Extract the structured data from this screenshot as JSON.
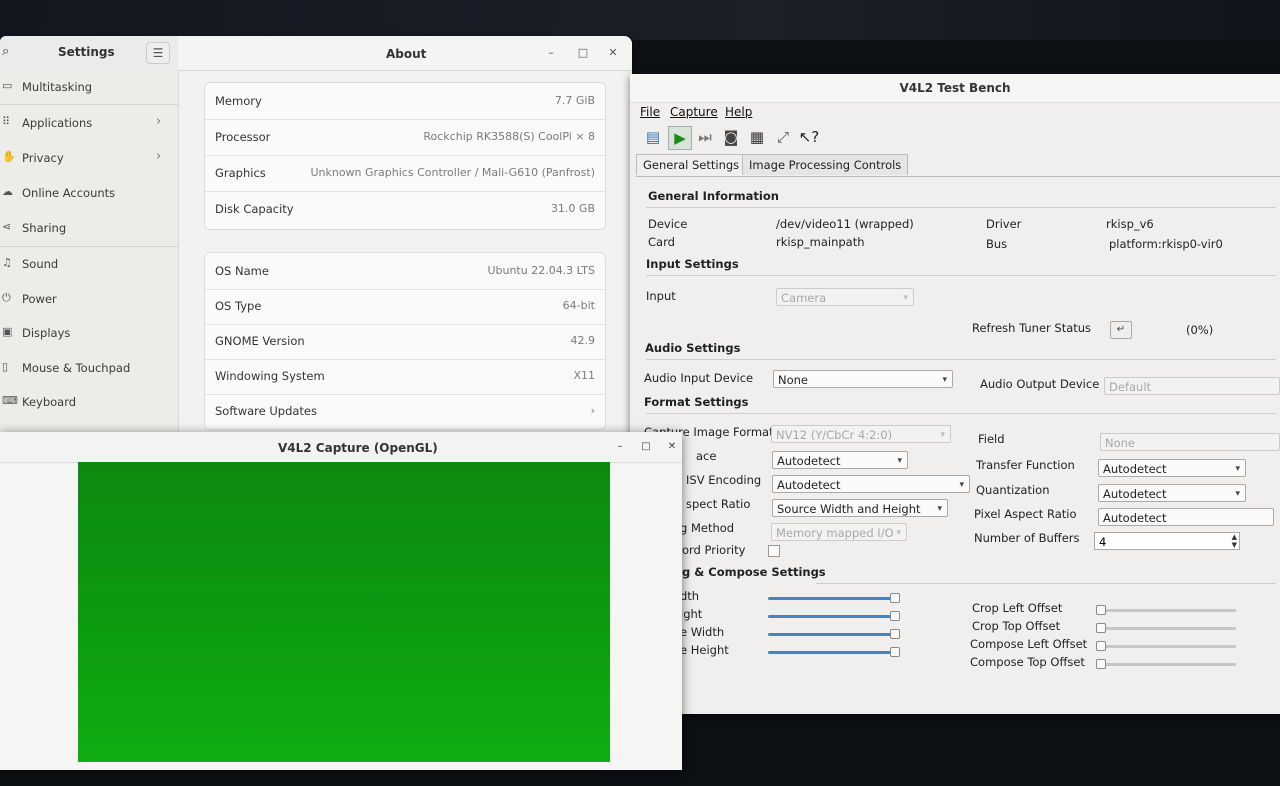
{
  "settings": {
    "title": "Settings",
    "page_title": "About",
    "window_controls": {
      "minimize": "–",
      "maximize": "□",
      "close": "✕"
    },
    "sidebar": [
      {
        "label": "Multitasking",
        "icon": "multitasking-icon",
        "chevron": ""
      },
      {
        "label": "Applications",
        "icon": "applications-icon",
        "chevron": "›"
      },
      {
        "label": "Privacy",
        "icon": "privacy-icon",
        "chevron": "›"
      },
      {
        "label": "Online Accounts",
        "icon": "online-accounts-icon",
        "chevron": ""
      },
      {
        "label": "Sharing",
        "icon": "sharing-icon",
        "chevron": ""
      },
      {
        "label": "Sound",
        "icon": "sound-icon",
        "chevron": ""
      },
      {
        "label": "Power",
        "icon": "power-icon",
        "chevron": ""
      },
      {
        "label": "Displays",
        "icon": "displays-icon",
        "chevron": ""
      },
      {
        "label": "Mouse & Touchpad",
        "icon": "mouse-icon",
        "chevron": ""
      },
      {
        "label": "Keyboard",
        "icon": "keyboard-icon",
        "chevron": ""
      }
    ],
    "hardware": [
      {
        "key": "Memory",
        "value": "7.7 GiB"
      },
      {
        "key": "Processor",
        "value": "Rockchip RK3588(S) CoolPi × 8"
      },
      {
        "key": "Graphics",
        "value": "Unknown Graphics Controller / Mali-G610 (Panfrost)"
      },
      {
        "key": "Disk Capacity",
        "value": "31.0 GB"
      }
    ],
    "software": [
      {
        "key": "OS Name",
        "value": "Ubuntu 22.04.3 LTS"
      },
      {
        "key": "OS Type",
        "value": "64-bit"
      },
      {
        "key": "GNOME Version",
        "value": "42.9"
      },
      {
        "key": "Windowing System",
        "value": "X11"
      },
      {
        "key": "Software Updates",
        "value": "›"
      }
    ]
  },
  "bench": {
    "title": "V4L2 Test Bench",
    "menu": [
      "File",
      "Capture",
      "Help"
    ],
    "tabs": [
      "General Settings",
      "Image Processing Controls"
    ],
    "general_info": {
      "header": "General Information",
      "device_label": "Device",
      "device": "/dev/video11 (wrapped)",
      "card_label": "Card",
      "card": "rkisp_mainpath",
      "driver_label": "Driver",
      "driver": "rkisp_v6",
      "bus_label": "Bus",
      "bus": "platform:rkisp0-vir0"
    },
    "input_settings": {
      "header": "Input Settings",
      "input_label": "Input",
      "input": "Camera",
      "refresh_label": "Refresh Tuner Status",
      "refresh_icon": "↵",
      "status": "(0%)"
    },
    "audio_settings": {
      "header": "Audio Settings",
      "in_label": "Audio Input Device",
      "in": "None",
      "out_label": "Audio Output Device",
      "out": "Default"
    },
    "format_settings": {
      "header": "Format Settings",
      "formats_label": "Capture Image Formats",
      "formats": "NV12 (Y/CbCr 4:2:0)",
      "field_label": "Field",
      "field": "None",
      "colorspace_label": "ace",
      "colorspace": "Autodetect",
      "transfer_label": "Transfer Function",
      "transfer": "Autodetect",
      "ycbcr_label": "ISV Encoding",
      "ycbcr": "Autodetect",
      "quant_label": "Quantization",
      "quant": "Autodetect",
      "video_aspect_label": "spect Ratio",
      "video_aspect": "Source Width and Height",
      "pixel_aspect_label": "Pixel Aspect Ratio",
      "pixel_aspect": "Autodetect",
      "method_label": "g Method",
      "method": "Memory mapped I/O",
      "buffers_label": "Number of Buffers",
      "buffers": "4",
      "priority_label": "ord Priority"
    },
    "crop_settings": {
      "header": "g & Compose Settings",
      "left": [
        {
          "label": "dth",
          "level": 1.0
        },
        {
          "label": "ight",
          "level": 1.0
        },
        {
          "label": "e Width",
          "level": 1.0
        },
        {
          "label": "e Height",
          "level": 1.0
        }
      ],
      "right": [
        {
          "label": "Crop Left Offset",
          "level": 0
        },
        {
          "label": "Crop Top Offset",
          "level": 0
        },
        {
          "label": "Compose Left Offset",
          "level": 0
        },
        {
          "label": "Compose Top Offset",
          "level": 0
        }
      ]
    }
  },
  "capture": {
    "title": "V4L2 Capture (OpenGL)",
    "window_controls": {
      "minimize": "–",
      "maximize": "□",
      "close": "✕"
    },
    "video_color": "#0c9a10"
  },
  "colors": {
    "accent": "#3f86c8",
    "video_green": "#0c9a10"
  }
}
